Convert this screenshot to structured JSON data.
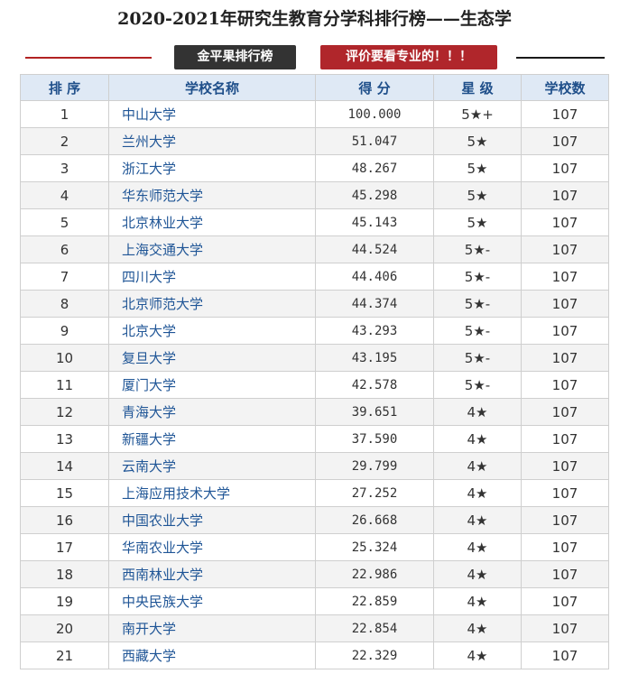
{
  "title": "2020-2021年研究生教育分学科排行榜——生态学",
  "badges": {
    "left": "金平果排行榜",
    "right": "评价要看专业的！！！"
  },
  "table": {
    "headers": [
      "排 序",
      "学校名称",
      "得 分",
      "星 级",
      "学校数"
    ],
    "rows": [
      [
        "1",
        "中山大学",
        "100.000",
        "5★+",
        "107"
      ],
      [
        "2",
        "兰州大学",
        "51.047",
        "5★",
        "107"
      ],
      [
        "3",
        "浙江大学",
        "48.267",
        "5★",
        "107"
      ],
      [
        "4",
        "华东师范大学",
        "45.298",
        "5★",
        "107"
      ],
      [
        "5",
        "北京林业大学",
        "45.143",
        "5★",
        "107"
      ],
      [
        "6",
        "上海交通大学",
        "44.524",
        "5★-",
        "107"
      ],
      [
        "7",
        "四川大学",
        "44.406",
        "5★-",
        "107"
      ],
      [
        "8",
        "北京师范大学",
        "44.374",
        "5★-",
        "107"
      ],
      [
        "9",
        "北京大学",
        "43.293",
        "5★-",
        "107"
      ],
      [
        "10",
        "复旦大学",
        "43.195",
        "5★-",
        "107"
      ],
      [
        "11",
        "厦门大学",
        "42.578",
        "5★-",
        "107"
      ],
      [
        "12",
        "青海大学",
        "39.651",
        "4★",
        "107"
      ],
      [
        "13",
        "新疆大学",
        "37.590",
        "4★",
        "107"
      ],
      [
        "14",
        "云南大学",
        "29.799",
        "4★",
        "107"
      ],
      [
        "15",
        "上海应用技术大学",
        "27.252",
        "4★",
        "107"
      ],
      [
        "16",
        "中国农业大学",
        "26.668",
        "4★",
        "107"
      ],
      [
        "17",
        "华南农业大学",
        "25.324",
        "4★",
        "107"
      ],
      [
        "18",
        "西南林业大学",
        "22.986",
        "4★",
        "107"
      ],
      [
        "19",
        "中央民族大学",
        "22.859",
        "4★",
        "107"
      ],
      [
        "20",
        "南开大学",
        "22.854",
        "4★",
        "107"
      ],
      [
        "21",
        "西藏大学",
        "22.329",
        "4★",
        "107"
      ]
    ]
  },
  "colors": {
    "accent_red": "#b0262b",
    "dark": "#333333",
    "header_bg": "#dfe9f5",
    "link_blue": "#1f5596"
  }
}
